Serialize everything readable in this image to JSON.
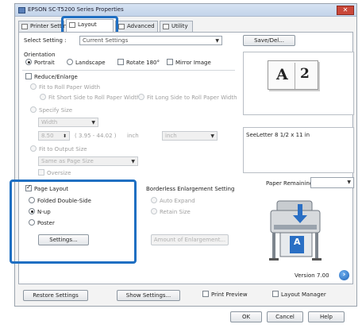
{
  "window": {
    "title": "EPSON SC-T5200 Series Properties",
    "close_label": "✕"
  },
  "tabs": [
    {
      "label": "Printer Settings"
    },
    {
      "label": "Layout"
    },
    {
      "label": "Advanced"
    },
    {
      "label": "Utility"
    }
  ],
  "select_setting": {
    "label": "Select Setting :",
    "value": "Current Settings",
    "save_del_label": "Save/Del..."
  },
  "orientation": {
    "label": "Orientation",
    "portrait": "Portrait",
    "landscape": "Landscape",
    "rotate": "Rotate 180°",
    "mirror": "Mirror Image"
  },
  "reduce_enlarge": {
    "label": "Reduce/Enlarge",
    "fit_roll_width": "Fit to Roll Paper Width",
    "fit_short_side": "Fit Short Side to Roll Paper Width",
    "fit_long_side": "Fit Long Side to Roll Paper Width",
    "specify_size": "Specify Size",
    "size_type": "Width",
    "value": "8.50",
    "range": "( 3.95 - 44.02 )",
    "unit_label": "inch",
    "unit_select": "inch",
    "fit_output_size": "Fit to Output Size",
    "output_size": "Same as Page Size",
    "oversize": "Oversize"
  },
  "page_layout": {
    "label": "Page Layout",
    "folded_double_side": "Folded Double-Side",
    "n_up": "N-up",
    "poster": "Poster",
    "settings_button": "Settings..."
  },
  "borderless": {
    "label": "Borderless Enlargement Setting",
    "auto_expand": "Auto Expand",
    "retain_size": "Retain Size",
    "amount_button": "Amount of Enlargement..."
  },
  "preview": {
    "page_letter": "A",
    "page_number": "2",
    "paper_info": "SeeLetter 8 1/2 x 11 in",
    "paper_remaining_label": "Paper Remaining:",
    "printer_letter": "A",
    "version": "Version 7.00"
  },
  "bottom_bar": {
    "restore_settings": "Restore Settings",
    "show_settings": "Show Settings...",
    "print_preview": "Print Preview",
    "layout_manager": "Layout Manager"
  },
  "dialog_buttons": {
    "ok": "OK",
    "cancel": "Cancel",
    "help": "Help"
  },
  "colors": {
    "highlight": "#1f6fc2",
    "accent": "#2a6fc4"
  }
}
